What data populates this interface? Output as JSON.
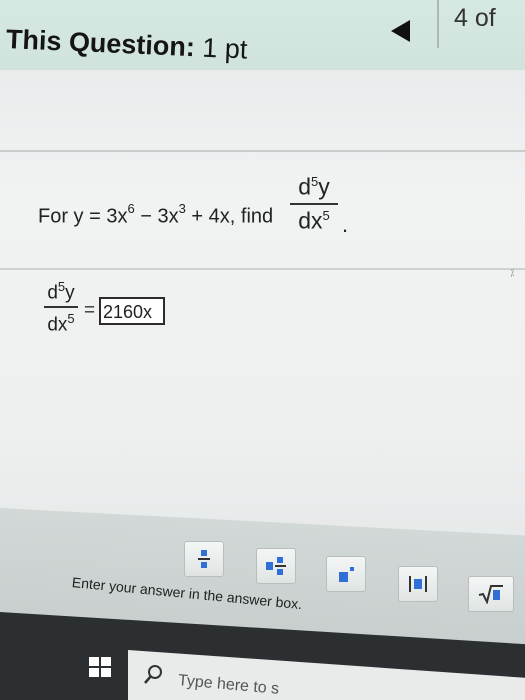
{
  "header": {
    "title": "This Question:",
    "points": "1 pt",
    "page_indicator": "4 of"
  },
  "problem": {
    "prefix": "For y = 3x",
    "exp1": "6",
    "term2": " − 3x",
    "exp2": "3",
    "term3": " + 4x, find",
    "frac_num": "d",
    "frac_num_exp": "5",
    "frac_num_var": "y",
    "frac_den": "dx",
    "frac_den_exp": "5",
    "period": "."
  },
  "answer": {
    "lhs_num": "d",
    "lhs_num_exp": "5",
    "lhs_num_var": "y",
    "lhs_den": "dx",
    "lhs_den_exp": "5",
    "equals": "=",
    "value": "2160x"
  },
  "toolbar": {
    "buttons": [
      "fraction",
      "mixed-number",
      "exponent",
      "absolute-value",
      "square-root"
    ],
    "hint": "Enter your answer in the answer box."
  },
  "taskbar": {
    "search_placeholder": "Type here to s"
  },
  "colors": {
    "header_bg": "#d6e8e2",
    "panel_bg": "#eef0f0",
    "toolbar_bg": "#cdd3d2",
    "taskbar_bg": "#2c2f31",
    "icon_blue": "#2f6fd6"
  }
}
